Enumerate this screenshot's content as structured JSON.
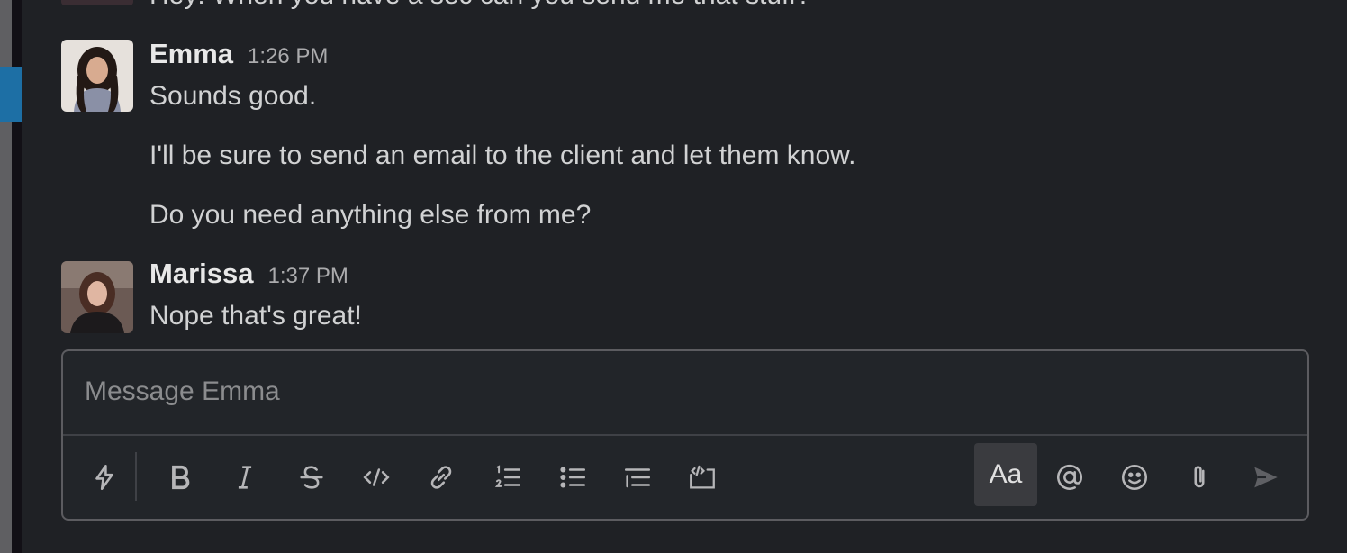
{
  "top_partial_message": "Hey! When you have a sec can you send me that stuff?",
  "messages": [
    {
      "sender": "Emma",
      "time": "1:26 PM",
      "lines": [
        "Sounds good.",
        "I'll be sure to send an email to the client and let them know.",
        "Do you need anything else from me?"
      ]
    },
    {
      "sender": "Marissa",
      "time": "1:37 PM",
      "lines": [
        "Nope that's great!"
      ]
    }
  ],
  "composer": {
    "placeholder": "Message Emma",
    "text_format_label": "Aa"
  },
  "icons": {
    "shortcuts": "lightning-icon",
    "bold": "bold-icon",
    "italic": "italic-icon",
    "strike": "strikethrough-icon",
    "code": "code-icon",
    "link": "link-icon",
    "ordered": "ordered-list-icon",
    "bullet": "bulleted-list-icon",
    "quote": "blockquote-icon",
    "codeblock": "code-block-icon",
    "mention": "mention-icon",
    "emoji": "emoji-icon",
    "attach": "attachment-icon",
    "send": "send-icon"
  },
  "colors": {
    "background": "#1f2125",
    "text": "#d1d2d3",
    "accent": "#1d6fa5"
  }
}
